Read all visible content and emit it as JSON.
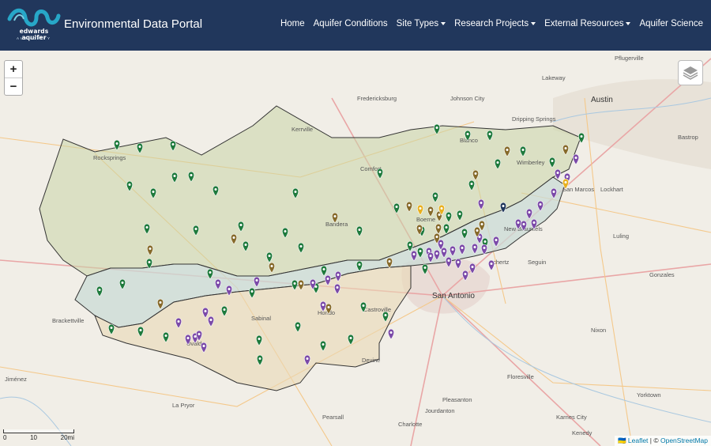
{
  "brand": {
    "logo_line1": "edwards aquifer",
    "logo_line2": "AUTHORITY",
    "title": "Environmental Data Portal"
  },
  "nav": [
    {
      "label": "Home",
      "dropdown": false
    },
    {
      "label": "Aquifer Conditions",
      "dropdown": false
    },
    {
      "label": "Site Types",
      "dropdown": true
    },
    {
      "label": "Research Projects",
      "dropdown": true
    },
    {
      "label": "External Resources",
      "dropdown": true
    },
    {
      "label": "Aquifer Science",
      "dropdown": false
    }
  ],
  "map": {
    "zoom_in": "+",
    "zoom_out": "−",
    "places": [
      "Pflugerville",
      "Lakeway",
      "Austin",
      "Fredericksburg",
      "Johnson City",
      "Dripping Springs",
      "Bastrop",
      "Rocksprings",
      "Blanco",
      "Wimberley",
      "Kerrville",
      "Comfort",
      "San Marcos",
      "Lockhart",
      "Bandera",
      "Boerne",
      "New Braunfels",
      "Luling",
      "Schertz",
      "Seguin",
      "Gonzales",
      "San Antonio",
      "Brackettville",
      "Sabinal",
      "Hondo",
      "Castroville",
      "Uvalde",
      "Devine",
      "Nixon",
      "Floresville",
      "Jiménez",
      "La Pryor",
      "Pleasanton",
      "Jourdanton",
      "Pearsall",
      "Charlotte",
      "Yorktown",
      "Karnes City",
      "Kenedy"
    ],
    "scale_labels": [
      "0",
      "10",
      "20mi"
    ],
    "attribution_leaflet": "🇺🇦 Leaflet",
    "attribution_sep": " | © ",
    "attribution_osm": "OpenStreetMap",
    "colors": {
      "green_marker": "#1e7a3c",
      "purple_marker": "#7b4aa8",
      "brown_marker": "#866a2a",
      "yellow_marker": "#e8b020",
      "navy": "#21375c"
    }
  }
}
